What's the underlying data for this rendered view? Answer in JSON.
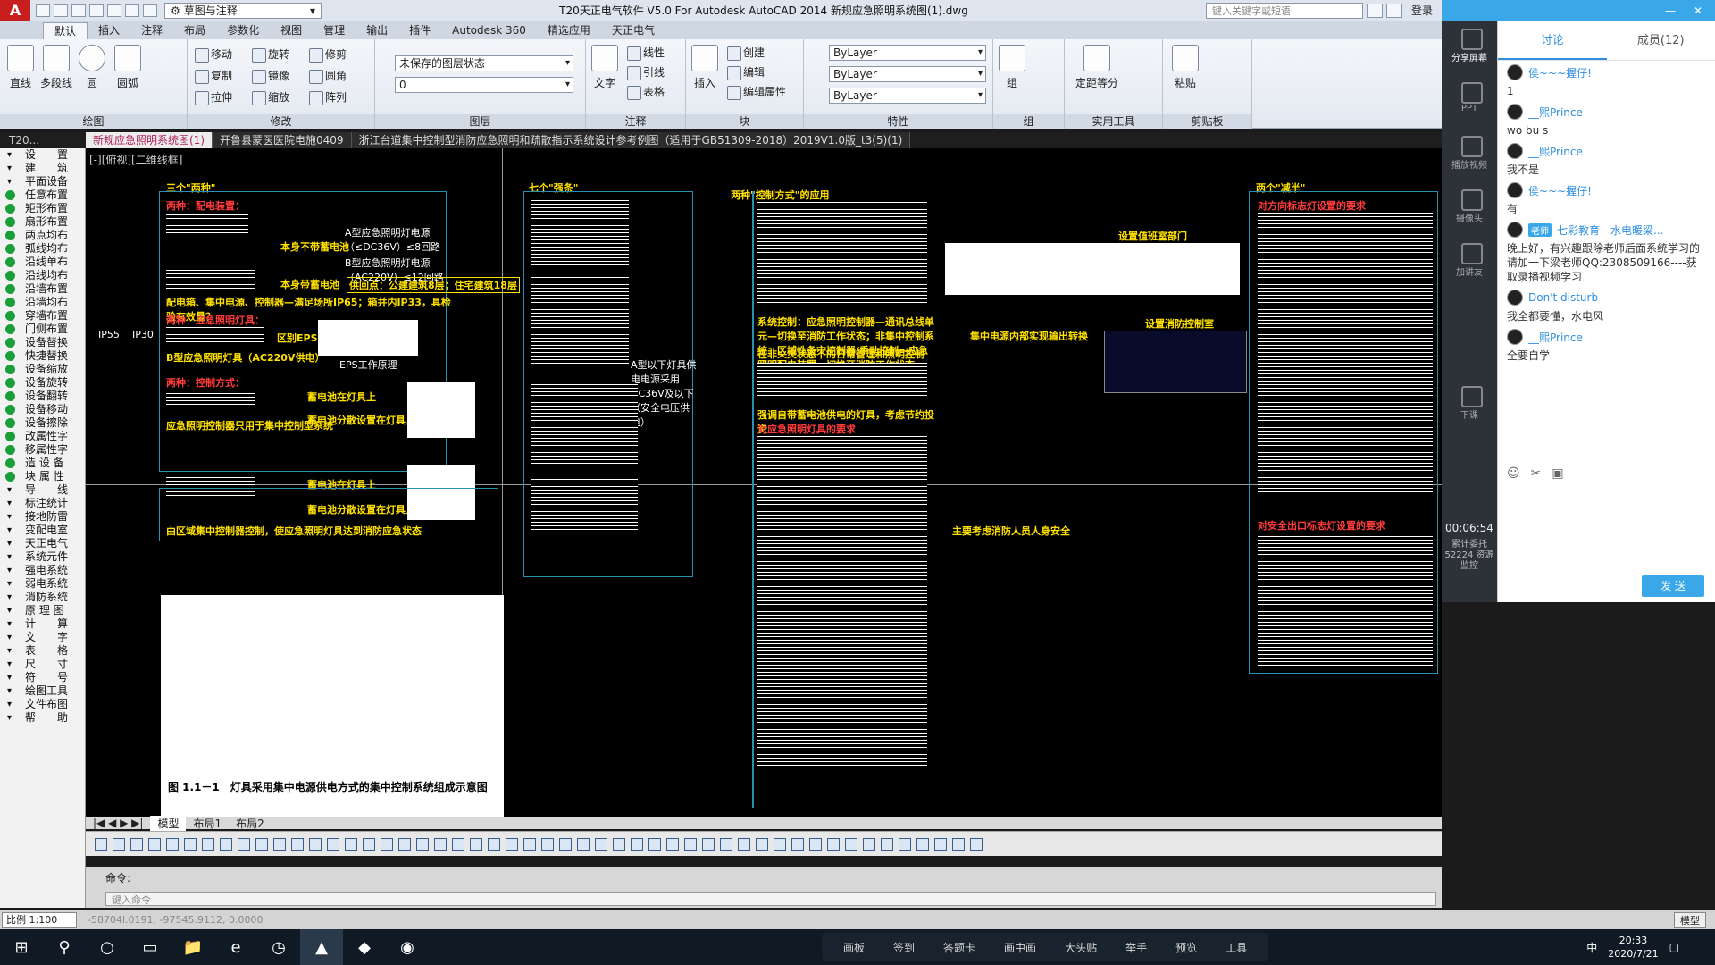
{
  "app": {
    "logo": "A",
    "workspace": "草图与注释",
    "title": "T20天正电气软件 V5.0 For Autodesk AutoCAD 2014    新规应急照明系统图(1).dwg",
    "search_placeholder": "键入关键字或短语",
    "login": "登录"
  },
  "ribbon_tabs": [
    "默认",
    "插入",
    "注释",
    "布局",
    "参数化",
    "视图",
    "管理",
    "输出",
    "插件",
    "Autodesk 360",
    "精选应用",
    "天正电气"
  ],
  "ribbon": {
    "draw": {
      "title": "绘图",
      "buttons": [
        "直线",
        "多段线",
        "圆",
        "圆弧"
      ]
    },
    "modify": {
      "title": "修改",
      "items": [
        "移动",
        "旋转",
        "修剪",
        "复制",
        "镜像",
        "圆角",
        "拉伸",
        "缩放",
        "阵列"
      ]
    },
    "layers": {
      "title": "图层",
      "state": "未保存的图层状态",
      "current": "0"
    },
    "annotation": {
      "title": "注释",
      "big": "文字",
      "items": [
        "线性",
        "引线",
        "表格"
      ]
    },
    "block": {
      "title": "块",
      "big": "插入",
      "items": [
        "创建",
        "编辑",
        "编辑属性"
      ]
    },
    "properties": {
      "title": "特性",
      "color": "ByLayer",
      "linetype": "ByLayer",
      "lineweight": "ByLayer"
    },
    "groups": {
      "title": "组",
      "big": "组"
    },
    "utilities": {
      "title": "实用工具",
      "big": "定距等分"
    },
    "clipboard": {
      "title": "剪贴板",
      "big": "粘贴"
    }
  },
  "doc_tabs": {
    "left_label": "T20...",
    "tabs": [
      "新规应急照明系统图(1)",
      "开鲁县蒙医医院电施0409",
      "浙江台道集中控制型消防应急照明和疏散指示系统设计参考例图（适用于GB51309-2018）2019V1.0版_t3(5)(1)"
    ]
  },
  "palette": [
    {
      "t": "设　　置",
      "h": true
    },
    {
      "t": "建　　筑",
      "h": true
    },
    {
      "t": "平面设备",
      "h": true
    },
    {
      "t": "任意布置",
      "i": true
    },
    {
      "t": "矩形布置",
      "i": true
    },
    {
      "t": "扇形布置",
      "i": true
    },
    {
      "t": "两点均布",
      "i": true
    },
    {
      "t": "弧线均布",
      "i": true
    },
    {
      "t": "沿线单布",
      "i": true
    },
    {
      "t": "沿线均布",
      "i": true
    },
    {
      "t": "沿墙布置",
      "i": true
    },
    {
      "t": "沿墙均布",
      "i": true
    },
    {
      "t": "穿墙布置",
      "i": true
    },
    {
      "t": "门侧布置",
      "i": true
    },
    {
      "t": "设备替换",
      "i": true
    },
    {
      "t": "快捷替换",
      "i": true
    },
    {
      "t": "设备缩放",
      "i": true
    },
    {
      "t": "设备旋转",
      "i": true
    },
    {
      "t": "设备翻转",
      "i": true
    },
    {
      "t": "设备移动",
      "i": true
    },
    {
      "t": "设备擦除",
      "i": true
    },
    {
      "t": "改属性字",
      "i": true
    },
    {
      "t": "移属性字",
      "i": true
    },
    {
      "t": "造 设 备",
      "i": true
    },
    {
      "t": "块 属 性",
      "i": true
    },
    {
      "t": "导　　线",
      "h": true
    },
    {
      "t": "标注统计",
      "h": true
    },
    {
      "t": "接地防雷",
      "h": true
    },
    {
      "t": "变配电室",
      "h": true
    },
    {
      "t": "天正电气",
      "h": true
    },
    {
      "t": "系统元件",
      "h": true
    },
    {
      "t": "强电系统",
      "h": true
    },
    {
      "t": "弱电系统",
      "h": true
    },
    {
      "t": "消防系统",
      "h": true
    },
    {
      "t": "原 理 图",
      "h": true
    },
    {
      "t": "计　　算",
      "h": true
    },
    {
      "t": "文　　字",
      "h": true
    },
    {
      "t": "表　　格",
      "h": true
    },
    {
      "t": "尺　　寸",
      "h": true
    },
    {
      "t": "符　　号",
      "h": true
    },
    {
      "t": "绘图工具",
      "h": true
    },
    {
      "t": "文件布图",
      "h": true
    },
    {
      "t": "帮　　助",
      "h": true
    }
  ],
  "canvas": {
    "view_label": "[-][俯视][二维线框]",
    "col1_title": "三个\"两种\"",
    "col2_title": "七个\"强条\"",
    "col3_title": "两种\"控制方式\"的应用",
    "col4_title": "两个\"减半\"",
    "notes": [
      "两种：配电装置：",
      "A型应急照明灯电源（≤DC36V）≤8回路",
      "B型应急照明灯电源（AC220V）≤12回路",
      "本身不带蓄电池",
      "本身带蓄电池",
      "供回点：公建建筑8层；住宅建筑18层",
      "配电箱、集中电源、控制器—满足场所IP65；箱并内IP33，具检验有效量？",
      "两种：应急照明灯具：",
      "区别EPS",
      "B型应急照明灯具（AC220V供电）",
      "EPS工作原理",
      "两种：控制方式：",
      "蓄电池在灯具上",
      "蓄电池分散设置在灯具上",
      "应急照明控制器只用于集中控制型系统",
      "由区域集中控制器控制，使应急照明灯具达到消防应急状态",
      "系统控制：应急照明控制器—通讯总线单元—切换至消防工作状态；非集中控制系统：区域性备灾控制器/手动控制—应急照明配电装置—切换至消防工作状态",
      "在非火灾状态下的日常管理和照明控制",
      "强调自带蓄电池供电的灯具，考虑节约投资",
      "对应急照明灯具的要求",
      "主要考虑消防人员人身安全",
      "设置值班室部门",
      "设置消防控制室",
      "集中电源内部实现输出转换",
      "A型以下灯具供电电源采用DC36V及以下（安全电压供电）",
      "对方向标志灯设置的要求",
      "对安全出口标志灯设置的要求",
      "图 1.1－1　灯具采用集中电源供电方式的集中控制系统组成示意图",
      "IP55",
      "IP30"
    ]
  },
  "layout_tabs": [
    "模型",
    "布局1",
    "布局2"
  ],
  "command": {
    "label": "命令:",
    "placeholder": "键入命令"
  },
  "status": {
    "scale": "比例 1:100",
    "coords": "-58704l.0191, -97545.9112, 0.0000",
    "model": "模型"
  },
  "live": {
    "sidebar": [
      "分享屏幕",
      "PPT",
      "播放视频",
      "摄像头",
      "加讲友"
    ],
    "end_label": "下课",
    "timer": "00:06:54",
    "stats": "累计委托 52224 资源监控"
  },
  "chat": {
    "tabs": [
      "讨论",
      "成员(12)"
    ],
    "messages": [
      {
        "who": "侯~~~握仔!",
        "text": "1"
      },
      {
        "who": "__熙Prince",
        "text": "wo bu s"
      },
      {
        "who": "__熙Prince",
        "text": "我不是"
      },
      {
        "who": "侯~~~握仔!",
        "text": "有"
      },
      {
        "who": "七彩教育—水电暖梁...",
        "badge": "老师",
        "text": "晚上好，有兴趣跟除老师后面系统学习的请加一下梁老师QQ:2308509166----获取录播视频学习"
      },
      {
        "who": "Don't disturb",
        "text": "我全都要懂，水电风"
      },
      {
        "who": "__熙Prince",
        "text": "全要自学"
      }
    ],
    "send": "发 送"
  },
  "taskbar": {
    "class_tools": [
      "画板",
      "签到",
      "答题卡",
      "画中画",
      "大头贴",
      "举手",
      "预览",
      "工具"
    ],
    "time": "20:33",
    "date": "2020/7/21",
    "ime": "中"
  }
}
